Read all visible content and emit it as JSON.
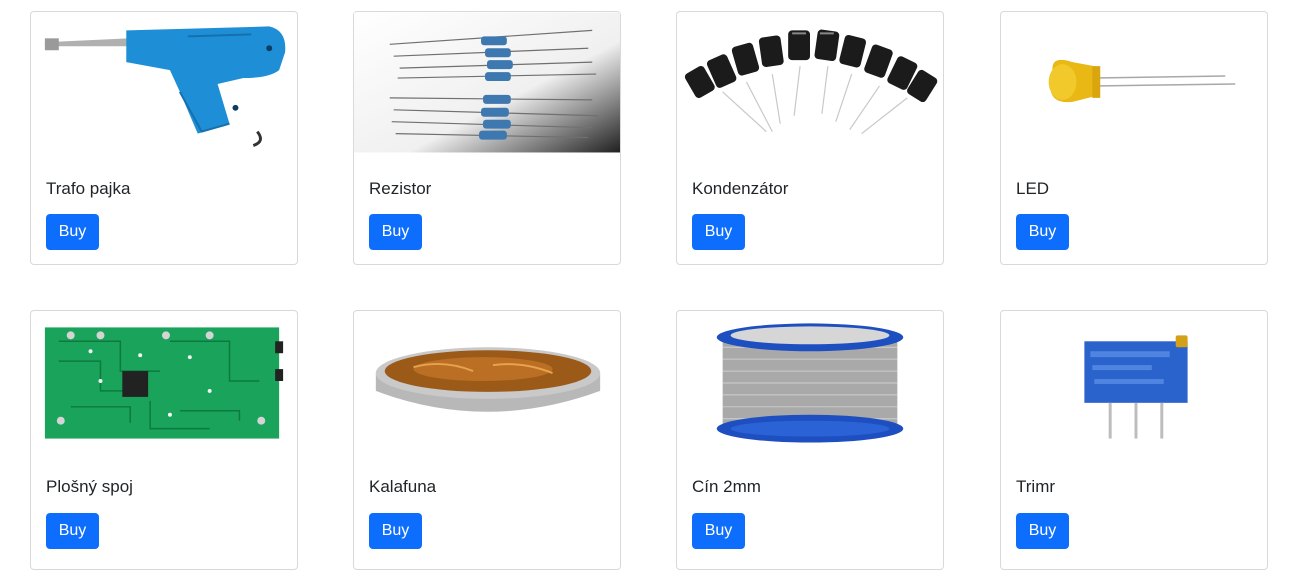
{
  "products": [
    {
      "name": "Trafo pajka",
      "button": "Buy",
      "image": "soldering-gun-image"
    },
    {
      "name": "Rezistor",
      "button": "Buy",
      "image": "resistors-image"
    },
    {
      "name": "Kondenzátor",
      "button": "Buy",
      "image": "capacitors-image"
    },
    {
      "name": "LED",
      "button": "Buy",
      "image": "led-image"
    },
    {
      "name": "Plošný spoj",
      "button": "Buy",
      "image": "pcb-image"
    },
    {
      "name": "Kalafuna",
      "button": "Buy",
      "image": "rosin-tin-image"
    },
    {
      "name": "Cín 2mm",
      "button": "Buy",
      "image": "solder-wire-spool-image"
    },
    {
      "name": "Trimr",
      "button": "Buy",
      "image": "trimmer-potentiometer-image"
    }
  ],
  "colors": {
    "button": "#0d6efd",
    "border": "#dee2e6"
  }
}
